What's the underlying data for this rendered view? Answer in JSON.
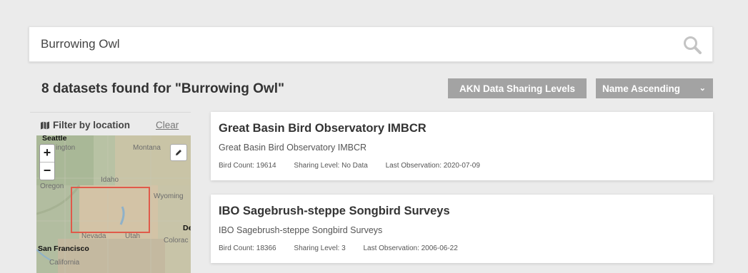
{
  "search": {
    "value": "Burrowing Owl",
    "icon": "search-icon"
  },
  "results": {
    "title": "8 datasets found for \"Burrowing Owl\""
  },
  "toolbar": {
    "sharing_levels_label": "AKN Data Sharing Levels",
    "sort_label": "Name Ascending",
    "sort_chevron": "⌄"
  },
  "filter": {
    "title": "Filter by location",
    "clear_label": "Clear",
    "zoom_in": "+",
    "zoom_out": "−",
    "map_labels": {
      "seattle": "Seattle",
      "washington": "ington",
      "montana": "Montana",
      "idaho": "Idaho",
      "oregon": "Oregon",
      "wyoming": "Wyoming",
      "nevada": "Nevada",
      "utah": "Utah",
      "colorado": "Colorac",
      "denver": "De",
      "san_francisco": "San Francisco",
      "california": "California"
    }
  },
  "datasets": [
    {
      "title": "Great Basin Bird Observatory IMBCR",
      "subtitle": "Great Basin Bird Observatory IMBCR",
      "bird_count": "Bird Count: 19614",
      "sharing_level": "Sharing Level: No Data",
      "last_observation": "Last Observation: 2020-07-09"
    },
    {
      "title": "IBO Sagebrush-steppe Songbird Surveys",
      "subtitle": "IBO Sagebrush-steppe Songbird Surveys",
      "bird_count": "Bird Count: 18366",
      "sharing_level": "Sharing Level: 3",
      "last_observation": "Last Observation: 2006-06-22"
    }
  ],
  "colors": {
    "background": "#ebebeb",
    "button_gray": "#a3a3a3",
    "bbox_red": "#e05a4a"
  }
}
